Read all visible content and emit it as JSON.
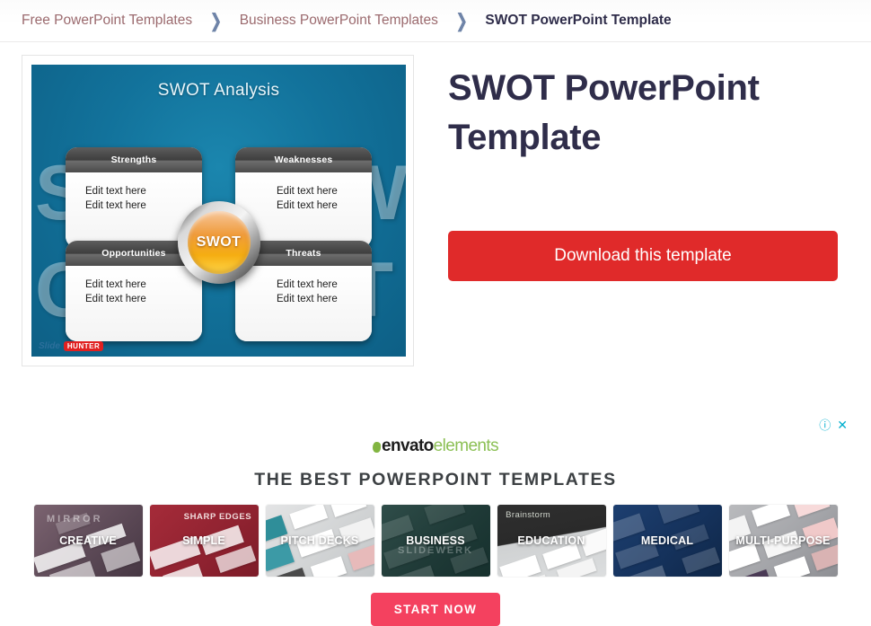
{
  "breadcrumb": {
    "separator": "❯",
    "items": [
      {
        "label": "Free PowerPoint Templates",
        "current": false
      },
      {
        "label": "Business PowerPoint Templates",
        "current": false
      },
      {
        "label": "SWOT PowerPoint Template",
        "current": true
      }
    ]
  },
  "detail": {
    "title": "SWOT PowerPoint Template",
    "download_label": "Download this template",
    "accent_color": "#e02a2a",
    "title_color": "#2f2d4a"
  },
  "preview": {
    "slide_title": "SWOT Analysis",
    "hub_label": "SWOT",
    "watermark_letters": [
      "S",
      "W",
      "O",
      "T"
    ],
    "background_color": "#12729b",
    "quadrants": [
      {
        "heading": "Strengths",
        "lines": [
          "Edit text here",
          "Edit text here"
        ]
      },
      {
        "heading": "Weaknesses",
        "lines": [
          "Edit text here",
          "Edit text here"
        ]
      },
      {
        "heading": "Opportunities",
        "lines": [
          "Edit text here",
          "Edit text here"
        ]
      },
      {
        "heading": "Threats",
        "lines": [
          "Edit text here",
          "Edit text here"
        ]
      }
    ],
    "logo": {
      "word1": "Slide",
      "word2": "HUNTER",
      "badge_color": "#e02020"
    }
  },
  "advertisement": {
    "info_icon": "ⓘ",
    "close_icon": "✕",
    "badge_color": "#00aecd",
    "brand": {
      "part1": "envato",
      "part2": "elements",
      "green": "#8cc055"
    },
    "headline": "THE BEST POWERPOINT TEMPLATES",
    "cta_label": "START NOW",
    "cta_color": "#f4415f",
    "cards": [
      {
        "label": "CREATIVE",
        "banner": "MIRROR",
        "color": "#6d5663"
      },
      {
        "label": "SIMPLE",
        "banner": "SHARP EDGES",
        "color": "#9e2533"
      },
      {
        "label": "PITCH DECKS",
        "banner": "",
        "color": "#d9dadb"
      },
      {
        "label": "BUSINESS",
        "banner": "SLIDEWERK",
        "color": "#253b39"
      },
      {
        "label": "EDUCATION",
        "banner": "Brainstorm",
        "color": "#2b2b2b"
      },
      {
        "label": "MEDICAL",
        "banner": "",
        "color": "#15335e"
      },
      {
        "label": "MULTI-PURPOSE",
        "banner": "",
        "color": "#8a8a8f"
      }
    ]
  }
}
